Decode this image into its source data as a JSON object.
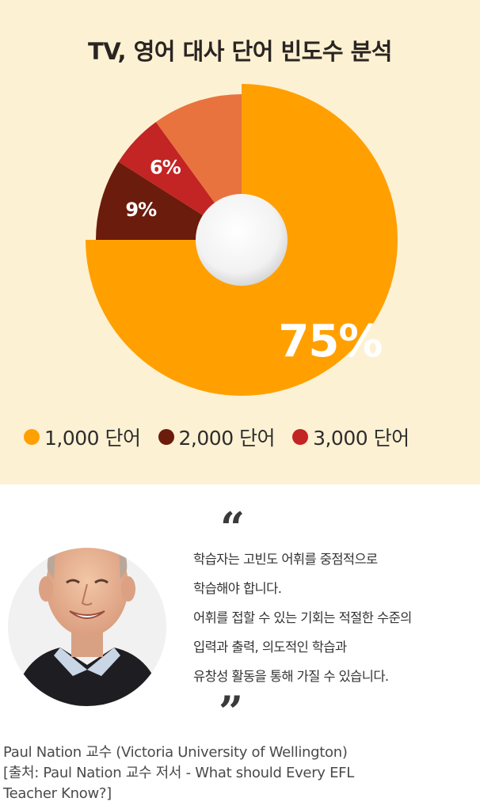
{
  "chart_data": {
    "type": "pie",
    "title": "TV, 영어 대사 단어 빈도수 분석",
    "slices": [
      {
        "label": "1,000 단어",
        "value": 75,
        "value_label": "75%",
        "color": "#ffa000"
      },
      {
        "label": "2,000 단어",
        "value": 9,
        "value_label": "9%",
        "color": "#6b1c0c"
      },
      {
        "label": "3,000 단어",
        "value": 6,
        "value_label": "6%",
        "color": "#c32424"
      },
      {
        "label": "",
        "value": 10,
        "value_label": "",
        "color": "#e8733e"
      }
    ],
    "legend_position": "bottom",
    "exploded_slice": "1,000 단어",
    "center_hole": true
  },
  "quote": {
    "open_mark": "“",
    "close_mark": "”",
    "lines": [
      "학습자는 고빈도 어휘를 중점적으로",
      "학습해야 합니다.",
      "어휘를 접할 수 있는 기회는 적절한 수준의",
      "입력과 출력, 의도적인 학습과",
      "유창성 활동을 통해 가질 수 있습니다."
    ]
  },
  "caption": {
    "lines": [
      "Paul Nation 교수 (Victoria University of Wellington)",
      "[출처: Paul Nation 교수 저서 - What should Every EFL",
      "Teacher Know?]"
    ]
  }
}
